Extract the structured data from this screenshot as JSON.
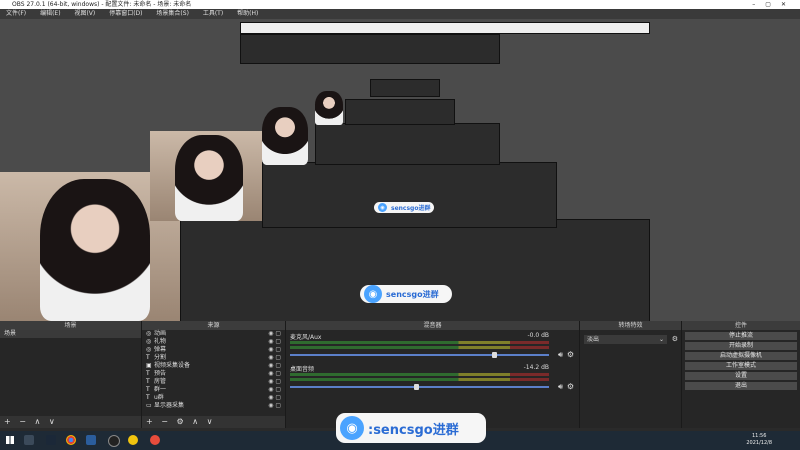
{
  "window": {
    "title": "OBS 27.0.1 (64-bit, windows) - 配置文件: 未命名 - 场景: 未命名"
  },
  "menu": [
    "文件(F)",
    "编辑(E)",
    "视图(V)",
    "停靠窗口(D)",
    "场景集合(S)",
    "工具(T)",
    "帮助(H)"
  ],
  "watermark": {
    "text": ":sencsgo进群",
    "small_text": "sencsgo进群"
  },
  "docks": {
    "scenes": {
      "title": "场景",
      "items": [
        "场景"
      ]
    },
    "sources": {
      "title": "来源",
      "items": [
        {
          "icon": "globe-icon",
          "label": "动画"
        },
        {
          "icon": "globe-icon",
          "label": "礼物"
        },
        {
          "icon": "globe-icon",
          "label": "弹幕"
        },
        {
          "icon": "text-icon",
          "label": "分割"
        },
        {
          "icon": "camera-icon",
          "label": "视频采集设备"
        },
        {
          "icon": "text-icon",
          "label": "预告"
        },
        {
          "icon": "text-icon",
          "label": "房管"
        },
        {
          "icon": "text-icon",
          "label": "群一"
        },
        {
          "icon": "text-icon",
          "label": "u群"
        },
        {
          "icon": "monitor-icon",
          "label": "显示器采集"
        }
      ]
    },
    "mixer": {
      "title": "混音器",
      "tracks": [
        {
          "name": "麦克风/Aux",
          "db": "-0.0 dB",
          "level": 0.78
        },
        {
          "name": "桌面音频",
          "db": "-14.2 dB",
          "level": 0.48
        }
      ]
    },
    "transitions": {
      "title": "转场特效",
      "selected": "淡出"
    },
    "controls": {
      "title": "控件",
      "buttons": [
        "停止推流",
        "开始录制",
        "启动虚拟摄像机",
        "工作室模式",
        "设置",
        "退出"
      ]
    }
  },
  "footer_icons": {
    "add": "+",
    "remove": "−",
    "up": "∧",
    "down": "∨"
  },
  "status": {
    "live": "LIVE: 00:00:00",
    "rec": "REC: 00:00:00",
    "cpu": "CPU: 3.5%, 60.00 fps"
  },
  "clock": {
    "time": "11:56",
    "date": "2021/12/8"
  },
  "colors": {
    "accent": "#4aa3ff",
    "meter_green": "#2f6b2f",
    "meter_red": "#7a2a2a"
  }
}
